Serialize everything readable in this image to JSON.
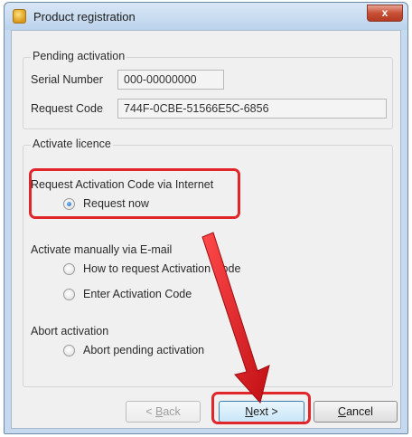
{
  "window": {
    "title": "Product registration",
    "close_label": "x"
  },
  "pending": {
    "title": "Pending activation",
    "serial_label": "Serial Number",
    "serial_value": "000-00000000",
    "request_label": "Request Code",
    "request_value": "744F-0CBE-51566E5C-6856"
  },
  "activate": {
    "title": "Activate licence",
    "internet_heading": "Request Activation Code via Internet",
    "request_now": "Request now",
    "email_heading": "Activate manually via E-mail",
    "how_to_request": "How to request Activation Code",
    "enter_code": "Enter Activation Code",
    "abort_heading": "Abort activation",
    "abort_pending": "Abort pending activation"
  },
  "buttons": {
    "back": {
      "prefix": "< ",
      "mnemonic": "B",
      "rest": "ack"
    },
    "next": {
      "mnemonic": "N",
      "rest": "ext >"
    },
    "cancel": {
      "mnemonic": "C",
      "rest": "ancel"
    }
  },
  "colors": {
    "highlight": "#e0262b",
    "arrow": "#d91a1f"
  }
}
